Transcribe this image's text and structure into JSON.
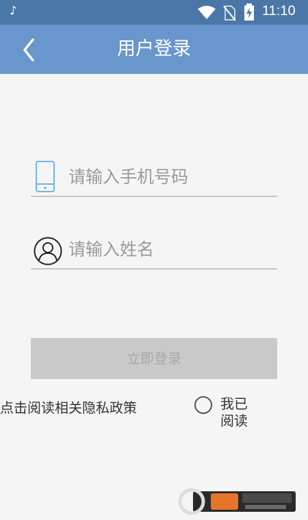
{
  "status_bar": {
    "time": "11:10",
    "icons": [
      "tiktok-icon",
      "wifi-icon",
      "no-sim-icon",
      "battery-charging-icon"
    ]
  },
  "app_bar": {
    "title": "用户登录",
    "back_icon": "chevron-left-icon",
    "background_color": "#6896cd"
  },
  "form": {
    "phone": {
      "placeholder": "请输入手机号码",
      "value": "",
      "icon": "phone-icon"
    },
    "name": {
      "placeholder": "请输入姓名",
      "value": "",
      "icon": "user-icon"
    },
    "login_button": {
      "label": "立即登录",
      "state": "disabled"
    }
  },
  "privacy": {
    "link_text": "点击阅读相关隐私政策",
    "read_label": "我已阅读",
    "checked": false
  },
  "colors": {
    "status_bar": "#4a77a8",
    "accent_icon": "#6fb4e6",
    "button_disabled": "#c9c9c9",
    "background": "#f5f5f5"
  }
}
